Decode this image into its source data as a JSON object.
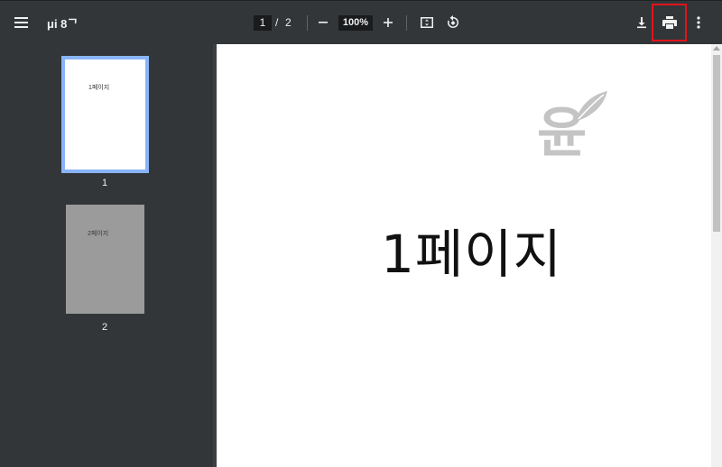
{
  "toolbar": {
    "menu_icon": "hamburger-menu-icon",
    "document_title": "μi 8ᄀ",
    "current_page": "1",
    "page_separator": "/",
    "total_pages": "2",
    "zoom_out_icon": "minus-icon",
    "zoom_level": "100%",
    "zoom_in_icon": "plus-icon",
    "fit_icon": "fit-to-page-icon",
    "rotate_icon": "rotate-icon",
    "download_icon": "download-icon",
    "print_icon": "print-icon",
    "more_icon": "more-vert-icon",
    "highlight_color": "#e0141c"
  },
  "sidebar": {
    "thumbnails": [
      {
        "label": "1페이지",
        "number": "1",
        "selected": true
      },
      {
        "label": "2페이지",
        "number": "2",
        "selected": false
      }
    ],
    "selected_border_color": "#8ab4f8"
  },
  "document": {
    "page_text": "1페이지",
    "watermark_text": "윤",
    "watermark_icon": "leaf-icon"
  },
  "colors": {
    "toolbar_bg": "#323639",
    "sidebar_bg": "#323639",
    "viewer_bg": "#525659"
  }
}
